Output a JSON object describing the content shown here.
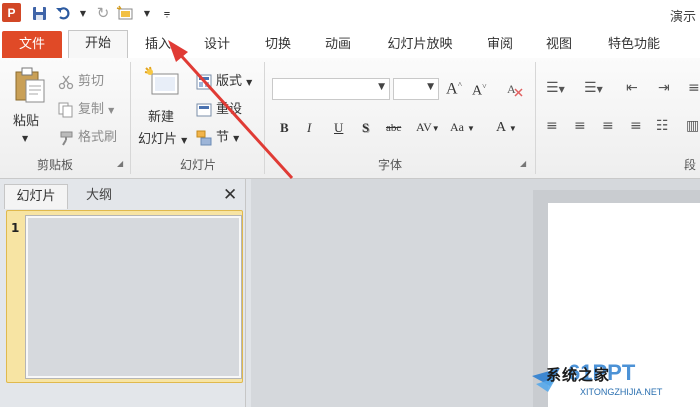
{
  "titlebar": {
    "app_icon": "P",
    "doc_title": "演示",
    "quick_access": [
      "save-icon",
      "undo-icon",
      "redo-icon",
      "new-slide-icon",
      "customize-icon"
    ]
  },
  "tabs": [
    "文件",
    "开始",
    "插入",
    "设计",
    "切换",
    "动画",
    "幻灯片放映",
    "审阅",
    "视图",
    "特色功能"
  ],
  "ribbon": {
    "clipboard": {
      "paste": "粘贴",
      "cut": "剪切",
      "copy": "复制",
      "format_painter": "格式刷",
      "label": "剪贴板"
    },
    "slides": {
      "new_line1": "新建",
      "new_line2": "幻灯片",
      "layout": "版式",
      "reset": "重设",
      "section": "节",
      "label": "幻灯片"
    },
    "font": {
      "bold": "B",
      "italic": "I",
      "underline": "U",
      "shadow": "S",
      "strike": "abc",
      "spacing": "AV",
      "case": "Aa",
      "grow": "A",
      "shrink": "A",
      "color": "A",
      "label": "字体"
    },
    "paragraph": {
      "label": "段"
    }
  },
  "pane": {
    "tab_slides": "幻灯片",
    "tab_outline": "大纲",
    "close": "✕",
    "slide_number": "1"
  },
  "watermark": {
    "brand": "系统之家",
    "logo_text": "61PPT",
    "url": "XITONGZHIJIA.NET"
  },
  "colors": {
    "file_tab": "#e04a27",
    "arrow": "#e03b35",
    "thumb_border": "#e0b94d"
  }
}
